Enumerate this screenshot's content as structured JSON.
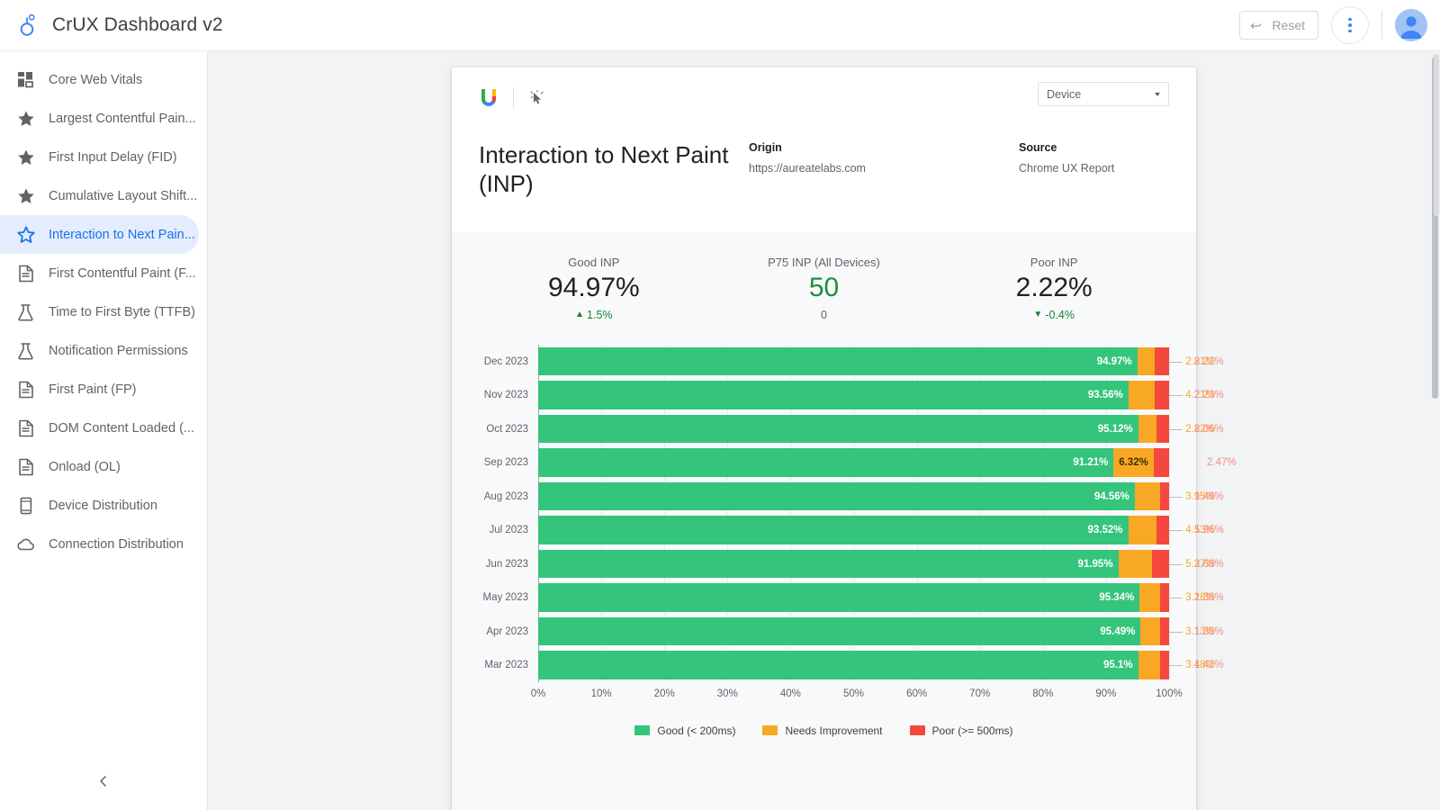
{
  "topbar": {
    "brand_title": "CrUX Dashboard v2",
    "brand_logo_icon": "crux-logo-icon",
    "reset_label": "Reset",
    "undo_icon": "undo-icon",
    "kebab_icon": "more-vertical-icon",
    "avatar_icon": "user-avatar-icon"
  },
  "sidebar": {
    "collapse_icon": "chevron-left-icon",
    "items": [
      {
        "label": "Core Web Vitals",
        "icon": "dashboard-grid-icon",
        "active": false
      },
      {
        "label": "Largest Contentful Pain...",
        "icon": "star-icon",
        "active": false
      },
      {
        "label": "First Input Delay (FID)",
        "icon": "star-icon",
        "active": false
      },
      {
        "label": "Cumulative Layout Shift...",
        "icon": "star-icon",
        "active": false
      },
      {
        "label": "Interaction to Next Pain...",
        "icon": "star-outline-icon",
        "active": true
      },
      {
        "label": "First Contentful Paint (F...",
        "icon": "document-icon",
        "active": false
      },
      {
        "label": "Time to First Byte (TTFB)",
        "icon": "flask-icon",
        "active": false
      },
      {
        "label": "Notification Permissions",
        "icon": "flask-icon",
        "active": false
      },
      {
        "label": "First Paint (FP)",
        "icon": "document-icon",
        "active": false
      },
      {
        "label": "DOM Content Loaded (...",
        "icon": "document-icon",
        "active": false
      },
      {
        "label": "Onload (OL)",
        "icon": "document-icon",
        "active": false
      },
      {
        "label": "Device Distribution",
        "icon": "mobile-device-icon",
        "active": false
      },
      {
        "label": "Connection Distribution",
        "icon": "cloud-icon",
        "active": false
      }
    ]
  },
  "report": {
    "logo_icon": "google-data-studio-icon",
    "cursor_icon": "pointer-cursor-icon",
    "device_filter": {
      "value": "Device",
      "caret_icon": "chevron-down-icon"
    },
    "title": "Interaction to Next Paint (INP)",
    "origin_label": "Origin",
    "origin_value": "https://aureatelabs.com",
    "source_label": "Source",
    "source_value": "Chrome UX Report"
  },
  "kpis": [
    {
      "label": "Good INP",
      "value": "94.97%",
      "delta": "1.5%",
      "delta_dir": "up",
      "tone": "dark"
    },
    {
      "label": "P75 INP (All Devices)",
      "value": "50",
      "delta": "0",
      "delta_dir": "none",
      "tone": "green"
    },
    {
      "label": "Poor INP",
      "value": "2.22%",
      "delta": "-0.4%",
      "delta_dir": "down",
      "tone": "dark"
    }
  ],
  "colors": {
    "good": "#34c47c",
    "needs_improvement": "#f9a825",
    "poor": "#f4483f",
    "accent": "#1a73e8",
    "kpi_green": "#1e8e3e"
  },
  "chart_data": {
    "type": "bar",
    "orientation": "horizontal",
    "stacked": true,
    "title": "Interaction to Next Paint (INP)",
    "xlabel": "",
    "ylabel": "",
    "xlim": [
      0,
      100
    ],
    "grid": true,
    "legend_position": "bottom",
    "tick_labels": [
      "0%",
      "10%",
      "20%",
      "30%",
      "40%",
      "50%",
      "60%",
      "70%",
      "80%",
      "90%",
      "100%"
    ],
    "categories": [
      "Dec 2023",
      "Nov 2023",
      "Oct 2023",
      "Sep 2023",
      "Aug 2023",
      "Jul 2023",
      "Jun 2023",
      "May 2023",
      "Apr 2023",
      "Mar 2023"
    ],
    "series": [
      {
        "name": "Good (< 200ms)",
        "color": "#34c47c",
        "values": [
          94.97,
          93.56,
          95.12,
          91.21,
          94.56,
          93.52,
          91.95,
          95.34,
          95.49,
          95.1
        ],
        "labels": [
          "94.97%",
          "93.56%",
          "95.12%",
          "91.21%",
          "94.56%",
          "93.52%",
          "91.95%",
          "95.34%",
          "95.49%",
          "95.1%"
        ]
      },
      {
        "name": "Needs Improvement",
        "color": "#f9a825",
        "values": [
          2.81,
          4.21,
          2.82,
          6.32,
          3.95,
          4.53,
          5.37,
          3.28,
          3.13,
          3.48
        ],
        "labels": [
          "2.81%",
          "4.21%",
          "2.82%",
          "6.32%",
          "3.95%",
          "4.53%",
          "5.37%",
          "3.28%",
          "3.13%",
          "3.48%"
        ]
      },
      {
        "name": "Poor (>= 500ms)",
        "color": "#f4483f",
        "values": [
          2.22,
          2.23,
          2.06,
          2.47,
          1.49,
          1.96,
          2.68,
          1.38,
          1.38,
          1.42
        ],
        "labels": [
          "2.22%",
          "2.23%",
          "2.06%",
          "2.47%",
          "1.49%",
          "1.96%",
          "2.68%",
          "1.38%",
          "1.38%",
          "1.42%"
        ]
      }
    ],
    "legend": [
      {
        "label": "Good (< 200ms)",
        "color": "#34c47c"
      },
      {
        "label": "Needs Improvement",
        "color": "#f9a825"
      },
      {
        "label": "Poor (>= 500ms)",
        "color": "#f4483f"
      }
    ]
  }
}
